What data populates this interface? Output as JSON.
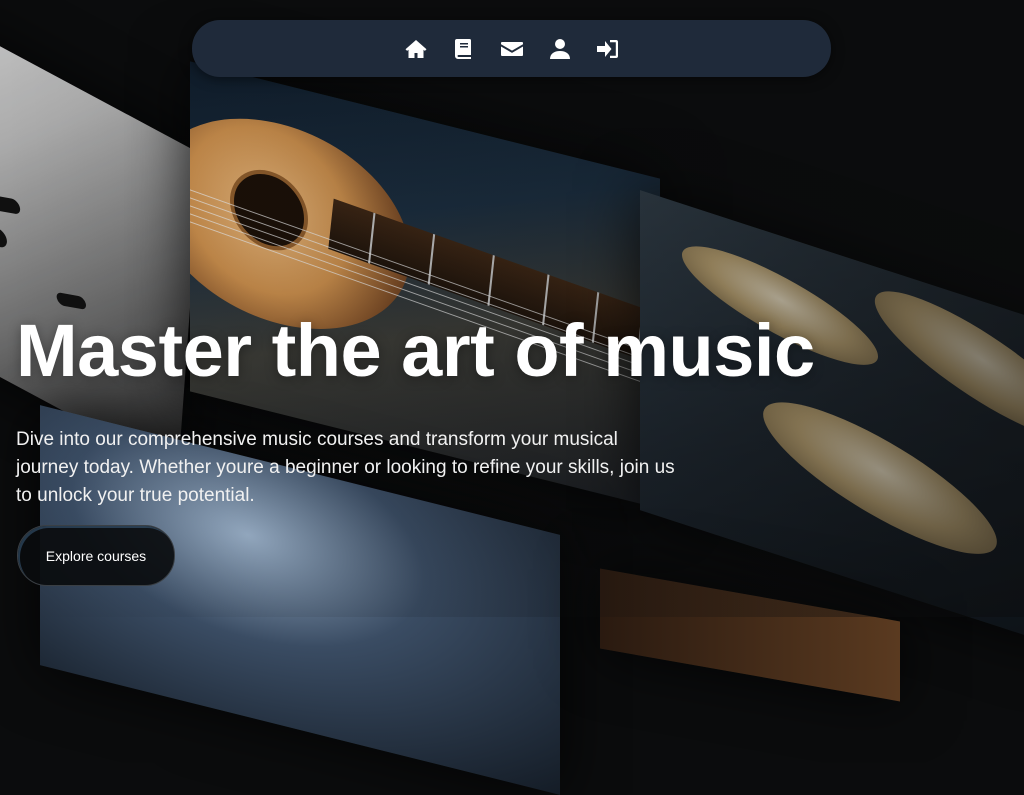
{
  "nav": {
    "items": [
      {
        "icon": "home-icon"
      },
      {
        "icon": "book-icon"
      },
      {
        "icon": "envelope-icon"
      },
      {
        "icon": "user-icon"
      },
      {
        "icon": "sign-in-icon"
      }
    ]
  },
  "hero": {
    "title": "Master the art of music",
    "description": "Dive into our comprehensive music courses and transform your musical journey today. Whether youre a beginner or looking to refine your skills, join us to unlock your true potential.",
    "cta_label": "Explore courses"
  },
  "colors": {
    "background": "#0b0c0d",
    "nav_background": "#1f2a3a",
    "text": "#ffffff"
  }
}
